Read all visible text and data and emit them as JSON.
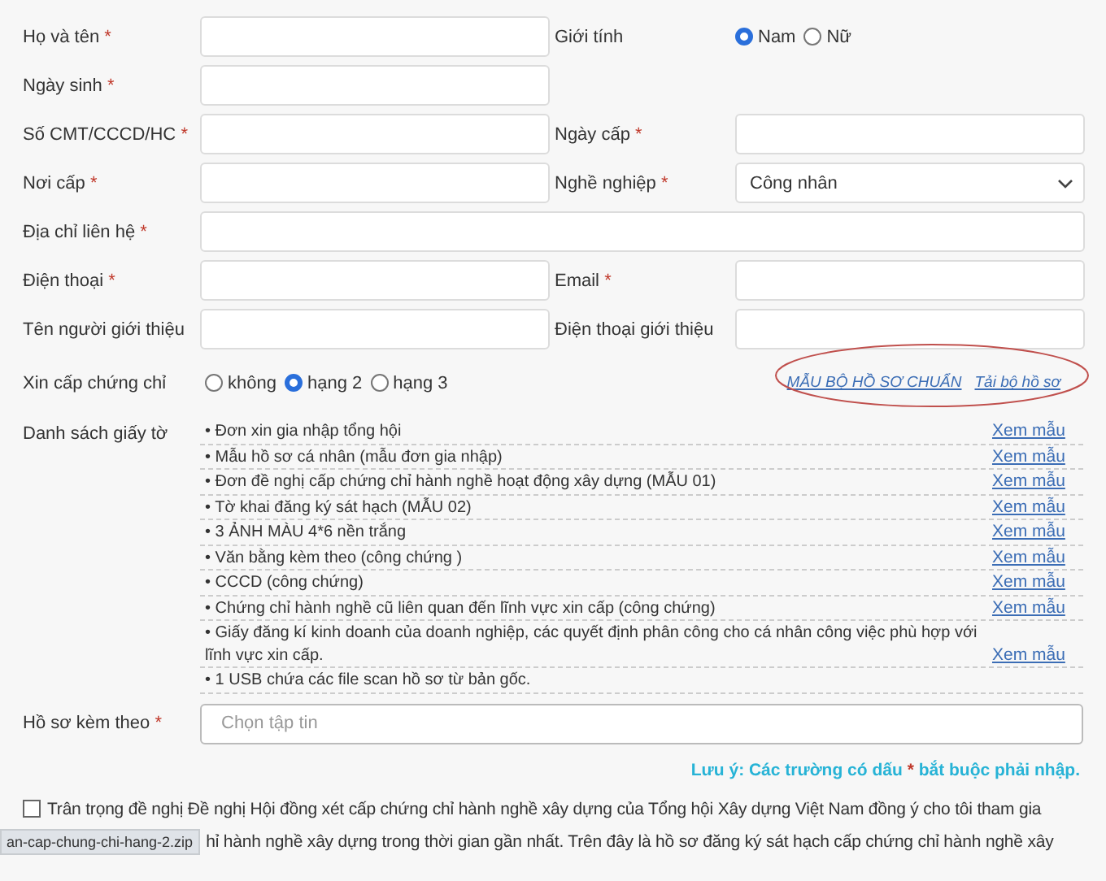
{
  "fields": [
    {
      "kind": "text",
      "label": "Họ và tên",
      "required": true
    },
    {
      "kind": "radio",
      "label": "Giới tính",
      "options": [
        {
          "label": "Nam",
          "selected": true
        },
        {
          "label": "Nữ",
          "selected": false
        }
      ]
    },
    {
      "kind": "text",
      "label": "Ngày sinh",
      "required": true
    },
    {
      "kind": "empty"
    },
    {
      "kind": "text",
      "label": "Số CMT/CCCD/HC",
      "required": true
    },
    {
      "kind": "text",
      "label": "Ngày cấp",
      "required": true
    },
    {
      "kind": "text",
      "label": "Nơi cấp",
      "required": true
    },
    {
      "kind": "select",
      "label": "Nghề nghiệp",
      "required": true,
      "value": "Công nhân"
    },
    {
      "kind": "wide",
      "label": "Địa chỉ liên hệ",
      "required": true
    },
    {
      "kind": "text",
      "label": "Điện thoại",
      "required": true
    },
    {
      "kind": "text",
      "label": "Email",
      "required": true
    },
    {
      "kind": "text",
      "label": "Tên người giới thiệu",
      "required": false
    },
    {
      "kind": "text",
      "label": "Điện thoại giới thiệu",
      "required": false
    }
  ],
  "certificate": {
    "label": "Xin cấp chứng chỉ",
    "options": [
      {
        "label": "không",
        "selected": false
      },
      {
        "label": "hạng 2",
        "selected": true
      },
      {
        "label": "hạng 3",
        "selected": false
      }
    ],
    "links": [
      "MẪU BỘ HỒ SƠ CHUẨN",
      "Tải bộ hồ sơ"
    ]
  },
  "documents": {
    "label": "Danh sách giấy tờ",
    "items": [
      {
        "text": "• Đơn xin gia nhập tổng hội",
        "link": "Xem mẫu"
      },
      {
        "text": "• Mẫu hồ sơ cá nhân (mẫu đơn gia nhập)",
        "link": "Xem mẫu"
      },
      {
        "text": "• Đơn đề nghị cấp chứng chỉ hành nghề hoạt động xây dựng (MẪU 01)",
        "link": "Xem mẫu"
      },
      {
        "text": "• Tờ khai đăng ký sát hạch (MẪU 02)",
        "link": "Xem mẫu"
      },
      {
        "text": "• 3 ẢNH MÀU 4*6 nền trắng",
        "link": "Xem mẫu"
      },
      {
        "text": "• Văn bằng kèm theo (công chứng )",
        "link": "Xem mẫu"
      },
      {
        "text": "• CCCD (công chứng)",
        "link": "Xem mẫu"
      },
      {
        "text": "• Chứng chỉ hành nghề cũ liên quan đến lĩnh vực xin cấp (công chứng)",
        "link": "Xem mẫu"
      },
      {
        "text": "• Giấy đăng kí kinh doanh của doanh nghiệp, các quyết định phân công cho cá nhân công việc phù hợp với lĩnh vực xin cấp.",
        "link": "Xem mẫu"
      },
      {
        "text": "• 1 USB chứa các file scan hồ sơ từ bản gốc."
      }
    ]
  },
  "attachment": {
    "label": "Hồ sơ kèm theo",
    "required": true,
    "placeholder": "Chọn tập tin"
  },
  "note": {
    "before": "Lưu ý: Các trường có dấu",
    "mark": "*",
    "after": "bắt buộc phải nhập."
  },
  "consent": {
    "checked": false,
    "line_1": "Trân trọng đề nghị Đề nghị Hội đồng xét cấp chứng chỉ hành nghề xây dựng của Tổng hội Xây dựng Việt Nam đồng ý cho tôi tham gia",
    "line_2": "hỉ hành nghề xây dựng trong thời gian gần nhất. Trên đây là hồ sơ đăng ký sát hạch cấp chứng chỉ hành nghề xây"
  },
  "status_bar": {
    "text": "an-cap-chung-chi-hang-2.zip"
  }
}
